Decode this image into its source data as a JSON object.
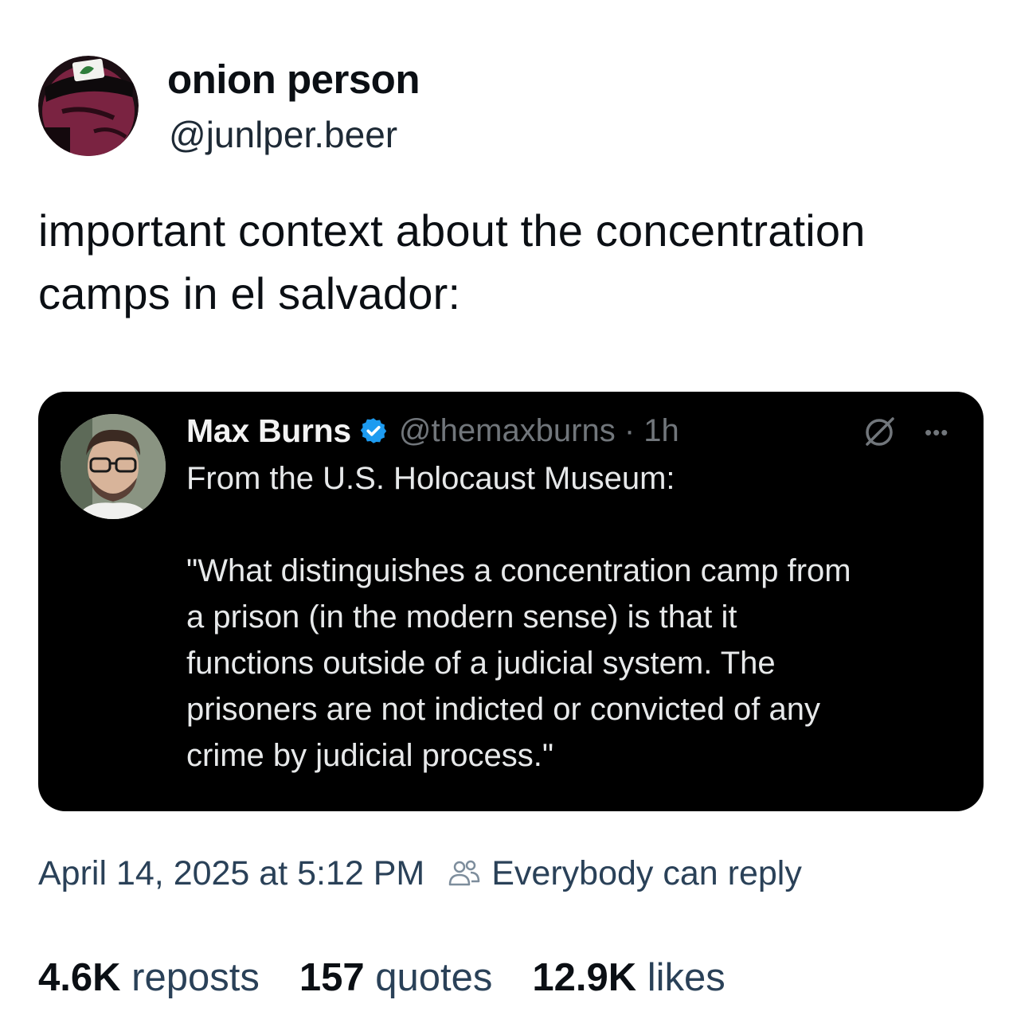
{
  "post": {
    "author": {
      "display_name": "onion person",
      "handle": "@junlper.beer",
      "avatar": "onion-avatar"
    },
    "text": "important context about the concentration camps in el salvador:",
    "embedded_post": {
      "author": {
        "display_name": "Max Burns",
        "handle_time": "@themaxburns · 1h",
        "verified": true,
        "avatar": "profile-photo"
      },
      "lines": [
        "From the U.S. Holocaust Museum:",
        "",
        "\"What distinguishes a concentration camp from",
        "a prison (in the modern sense) is that it",
        "functions outside of a judicial system. The",
        "prisoners are not indicted or convicted of any",
        "crime by judicial process.\""
      ],
      "icons": [
        "grok-icon",
        "more-icon"
      ]
    },
    "timestamp": "April 14, 2025 at 5:12 PM",
    "reply_setting": "Everybody can reply",
    "stats": [
      {
        "count": "4.6K",
        "label": "reposts"
      },
      {
        "count": "157",
        "label": "quotes"
      },
      {
        "count": "12.9K",
        "label": "likes"
      }
    ]
  },
  "colors": {
    "background": "#ffffff",
    "text": "#0b0f14",
    "muted_text": "#2a4158",
    "card_background": "#000000",
    "card_text": "#e7e9ea",
    "verified_badge": "#1d9bf0"
  }
}
